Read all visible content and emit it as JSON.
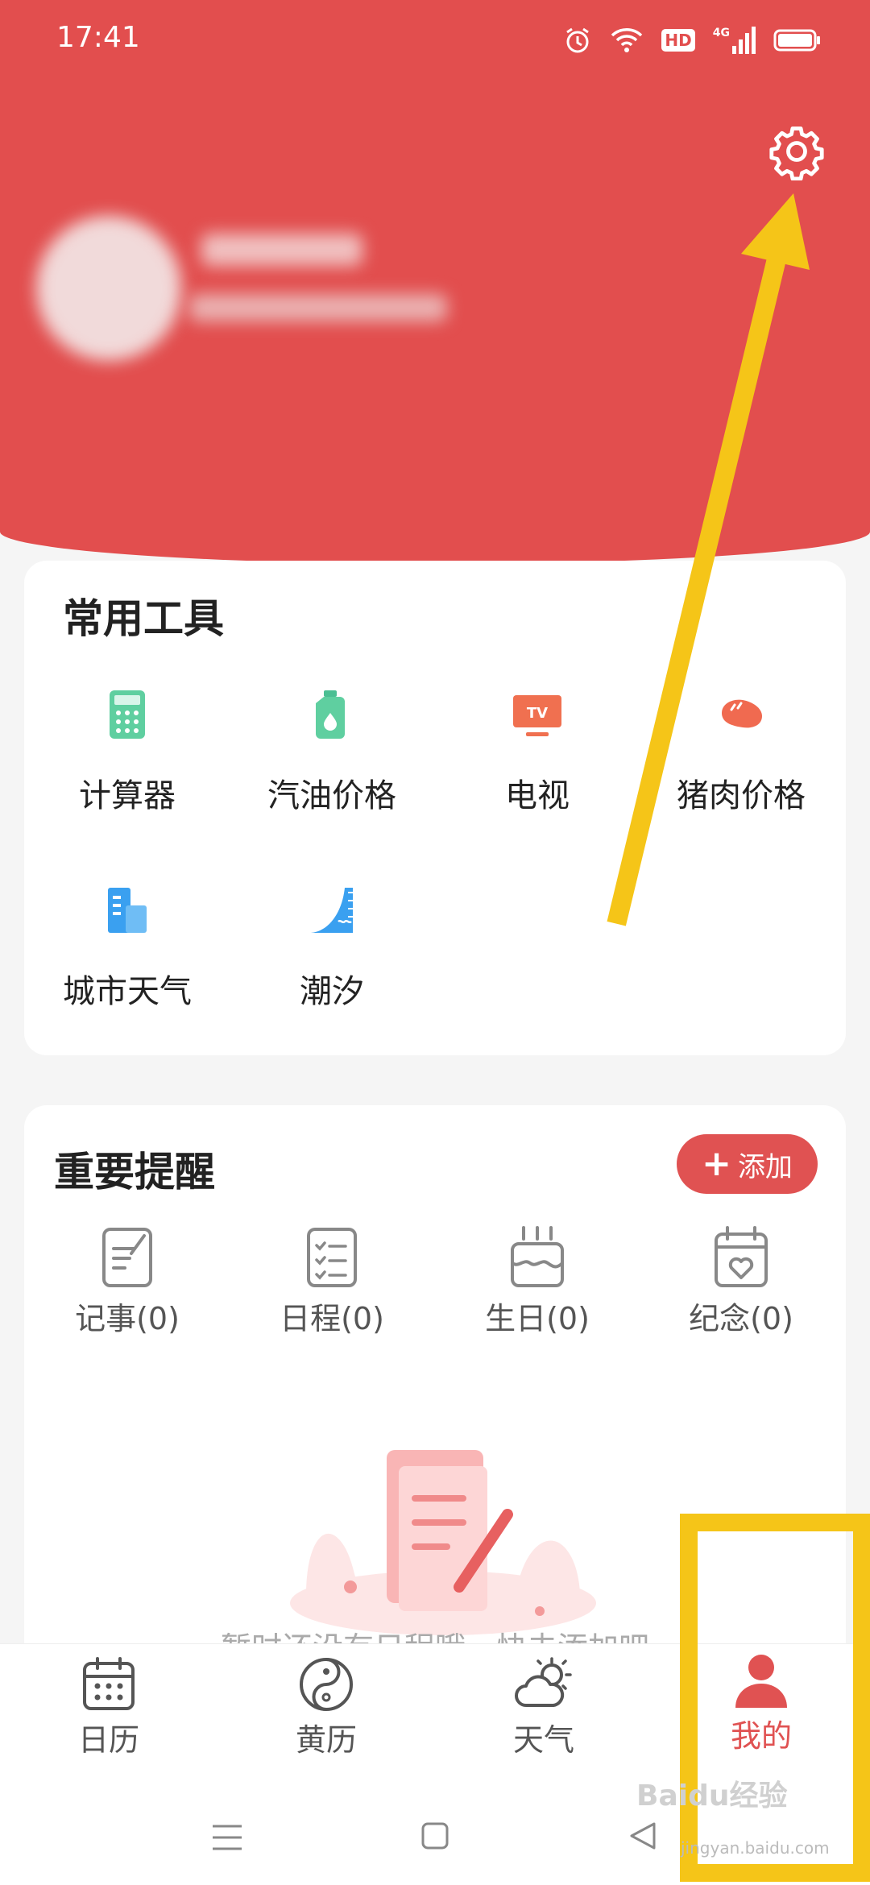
{
  "status": {
    "time": "17:41",
    "icons": [
      "alarm-icon",
      "wifi-icon",
      "hd-icon",
      "4g-signal-icon",
      "battery-icon"
    ],
    "hd_label": "HD",
    "net_label": "4G"
  },
  "header": {
    "settings_icon": "gear-icon",
    "accent": "#e24e4e"
  },
  "tools": {
    "title": "常用工具",
    "items": [
      {
        "label": "计算器",
        "icon": "calculator-icon"
      },
      {
        "label": "汽油价格",
        "icon": "fuel-icon"
      },
      {
        "label": "电视",
        "icon": "tv-icon"
      },
      {
        "label": "猪肉价格",
        "icon": "meat-icon"
      },
      {
        "label": "城市天气",
        "icon": "city-weather-icon"
      },
      {
        "label": "潮汐",
        "icon": "tide-icon"
      }
    ],
    "tv_icon_text": "TV"
  },
  "reminders": {
    "title": "重要提醒",
    "add_label": "添加",
    "items": [
      {
        "label": "记事(0)",
        "icon": "note-icon"
      },
      {
        "label": "日程(0)",
        "icon": "schedule-icon"
      },
      {
        "label": "生日(0)",
        "icon": "birthday-cake-icon"
      },
      {
        "label": "纪念(0)",
        "icon": "anniversary-icon"
      }
    ],
    "empty_text": "暂时还没有日程哦，快去添加吧"
  },
  "tabbar": {
    "items": [
      {
        "label": "日历",
        "icon": "calendar-icon"
      },
      {
        "label": "黄历",
        "icon": "yin-yang-icon"
      },
      {
        "label": "天气",
        "icon": "weather-icon"
      },
      {
        "label": "我的",
        "icon": "user-icon",
        "active": true
      }
    ]
  },
  "watermark": {
    "brand": "Baidu经验",
    "url": "jingyan.baidu.com"
  }
}
